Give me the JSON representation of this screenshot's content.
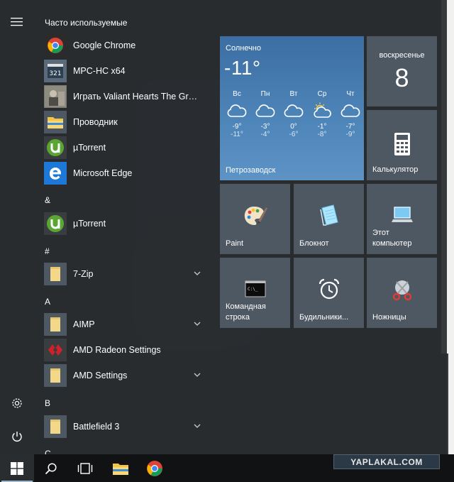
{
  "start_menu": {
    "most_used_title": "Часто используемые",
    "most_used": [
      {
        "label": "Google Chrome",
        "icon": "chrome-icon"
      },
      {
        "label": "MPC-HC x64",
        "icon": "mpc-hc-icon"
      },
      {
        "label": "Играть Valiant Hearts The Great...",
        "icon": "valiant-hearts-icon"
      },
      {
        "label": "Проводник",
        "icon": "file-explorer-icon"
      },
      {
        "label": "µTorrent",
        "icon": "utorrent-icon"
      },
      {
        "label": "Microsoft Edge",
        "icon": "edge-icon"
      }
    ],
    "groups": [
      {
        "letter": "&",
        "items": [
          {
            "label": "µTorrent",
            "icon": "utorrent-icon"
          }
        ]
      },
      {
        "letter": "#",
        "items": [
          {
            "label": "7-Zip",
            "icon": "folder-icon",
            "expandable": true
          }
        ]
      },
      {
        "letter": "A",
        "items": [
          {
            "label": "AIMP",
            "icon": "folder-icon",
            "expandable": true
          },
          {
            "label": "AMD Radeon Settings",
            "icon": "amd-radeon-icon"
          },
          {
            "label": "AMD Settings",
            "icon": "folder-icon",
            "expandable": true
          }
        ]
      },
      {
        "letter": "B",
        "items": [
          {
            "label": "Battlefield 3",
            "icon": "folder-icon",
            "expandable": true
          }
        ]
      },
      {
        "letter": "C",
        "items": []
      }
    ]
  },
  "tiles": {
    "weather": {
      "condition": "Солнечно",
      "temperature": "-11°",
      "location": "Петрозаводск",
      "forecast": [
        {
          "day": "Вс",
          "high": "-9°",
          "low": "-11°",
          "icon": "cloud-icon"
        },
        {
          "day": "Пн",
          "high": "-3°",
          "low": "-4°",
          "icon": "cloud-icon"
        },
        {
          "day": "Вт",
          "high": "0°",
          "low": "-6°",
          "icon": "cloud-icon"
        },
        {
          "day": "Ср",
          "high": "-1°",
          "low": "-8°",
          "icon": "partly-sunny-icon"
        },
        {
          "day": "Чт",
          "high": "-7°",
          "low": "-9°",
          "icon": "cloud-icon"
        }
      ]
    },
    "calendar": {
      "weekday": "воскресенье",
      "date": "8"
    },
    "calculator": {
      "label": "Калькулятор"
    },
    "paint": {
      "label": "Paint"
    },
    "notepad": {
      "label": "Блокнот"
    },
    "this_pc": {
      "label_line1": "Этот",
      "label_line2": "компьютер"
    },
    "cmd": {
      "label_line1": "Командная",
      "label_line2": "строка"
    },
    "alarms": {
      "label": "Будильники..."
    },
    "snipping": {
      "label": "Ножницы"
    }
  },
  "taskbar": {
    "watermark": "YAPLAKAL.COM"
  },
  "colors": {
    "tile": "#4d5863",
    "weather_tile": "#4d84b8",
    "taskbar": "#101214"
  }
}
